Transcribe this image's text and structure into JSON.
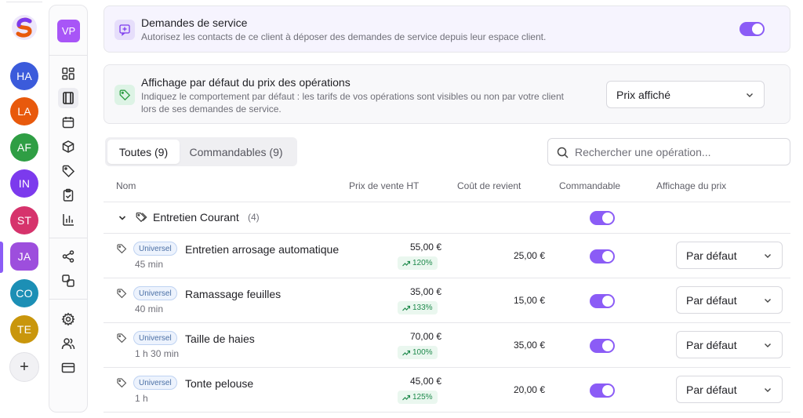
{
  "workspaces": [
    {
      "initials": "HA",
      "color": "#3b5bdb"
    },
    {
      "initials": "LA",
      "color": "#e8590c"
    },
    {
      "initials": "AF",
      "color": "#2f9e44"
    },
    {
      "initials": "IN",
      "color": "#7c3aed"
    },
    {
      "initials": "ST",
      "color": "#d6336c"
    },
    {
      "initials": "JA",
      "color": "#9d4edd"
    },
    {
      "initials": "CO",
      "color": "#1c8fb5"
    },
    {
      "initials": "TE",
      "color": "#c9960c"
    }
  ],
  "add_workspace": "+",
  "client_avatar": "VP",
  "service_requests": {
    "title": "Demandes de service",
    "description": "Autorisez les contacts de ce client à déposer des demandes de service depuis leur espace client.",
    "enabled": true
  },
  "price_display": {
    "title": "Affichage par défaut du prix des opérations",
    "description_line1": "Indiquez le comportement par défaut : les tarifs de vos opérations sont visibles ou non par votre client",
    "description_line2": "lors de ses demandes de service.",
    "selected": "Prix affiché"
  },
  "tabs": {
    "all": "Toutes (9)",
    "orderable": "Commandables (9)"
  },
  "search": {
    "placeholder": "Rechercher une opération..."
  },
  "columns": {
    "name": "Nom",
    "price": "Prix de vente HT",
    "cost": "Coût de revient",
    "orderable": "Commandable",
    "price_display": "Affichage du prix"
  },
  "group": {
    "name": "Entretien Courant",
    "count": "(4)",
    "orderable": true
  },
  "operations": [
    {
      "badge": "Universel",
      "name": "Entretien arrosage automatique",
      "duration": "45 min",
      "price": "55,00 €",
      "margin": "120%",
      "cost": "25,00 €",
      "orderable": true,
      "display": "Par défaut"
    },
    {
      "badge": "Universel",
      "name": "Ramassage feuilles",
      "duration": "40 min",
      "price": "35,00 €",
      "margin": "133%",
      "cost": "15,00 €",
      "orderable": true,
      "display": "Par défaut"
    },
    {
      "badge": "Universel",
      "name": "Taille de haies",
      "duration": "1 h 30 min",
      "price": "70,00 €",
      "margin": "100%",
      "cost": "35,00 €",
      "orderable": true,
      "display": "Par défaut"
    },
    {
      "badge": "Universel",
      "name": "Tonte pelouse",
      "duration": "1 h",
      "price": "45,00 €",
      "margin": "125%",
      "cost": "20,00 €",
      "orderable": true,
      "display": "Par défaut"
    }
  ],
  "colors": {
    "accent": "#8b5cf6",
    "positive": "#1f8a4c"
  }
}
